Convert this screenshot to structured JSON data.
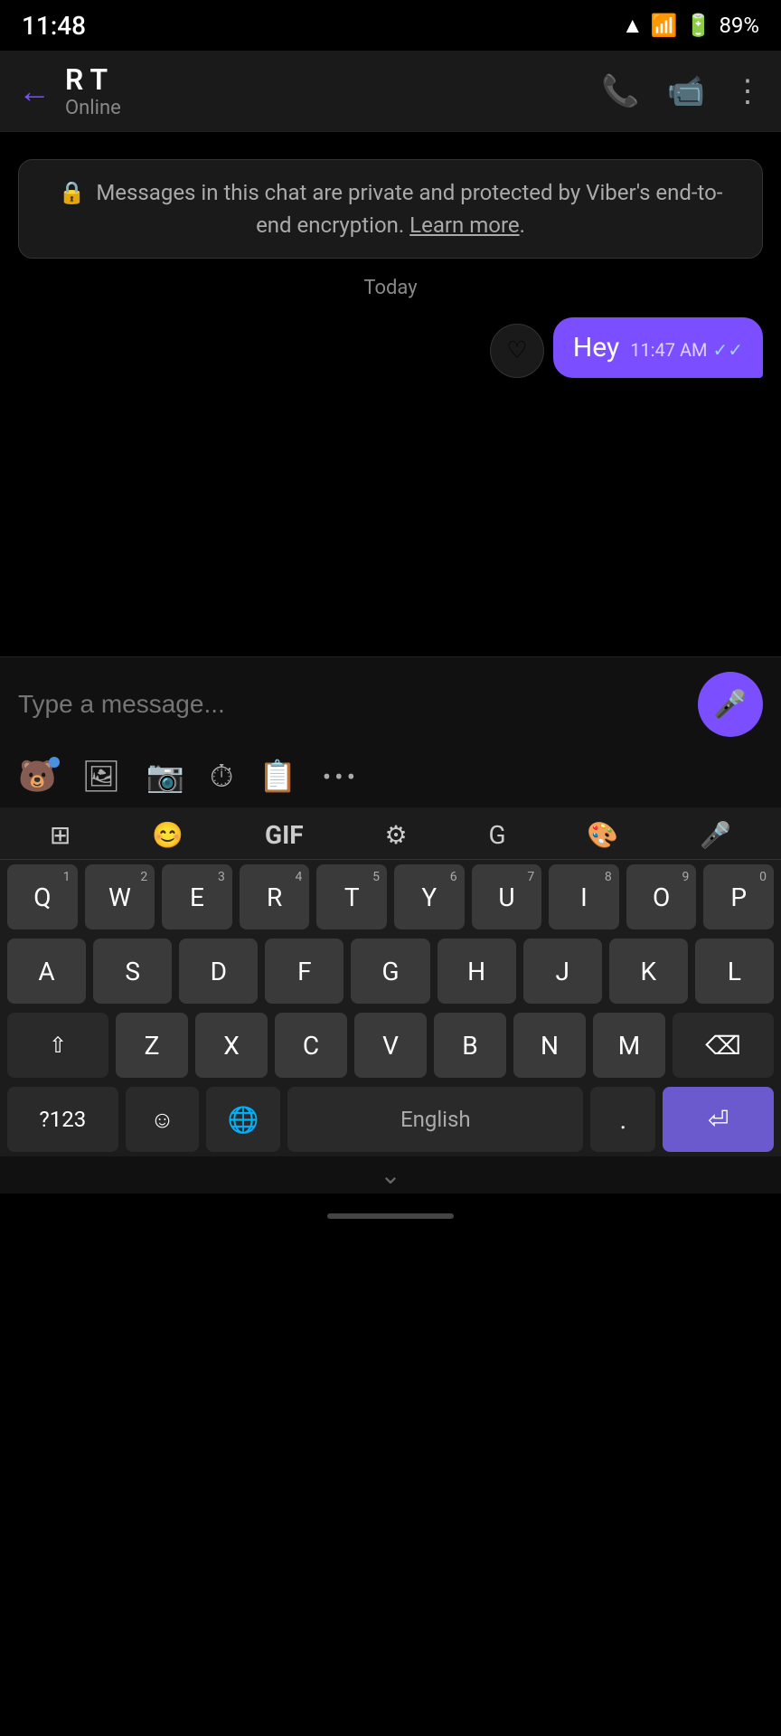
{
  "status_bar": {
    "time": "11:48",
    "battery": "89%"
  },
  "header": {
    "back_label": "←",
    "contact_name": "R T",
    "contact_status": "Online",
    "call_icon": "📞",
    "video_icon": "📹",
    "more_icon": "⋮"
  },
  "chat": {
    "encryption_notice": "Messages in this chat are private and protected by Viber's end-to-end encryption.",
    "learn_more": "Learn more",
    "date_label": "Today",
    "messages": [
      {
        "text": "Hey",
        "time": "11:47 AM",
        "ticks": "✓✓",
        "like_icon": "♡"
      }
    ]
  },
  "input_bar": {
    "placeholder": "Type a message...",
    "mic_icon": "🎤"
  },
  "toolbar": {
    "sticker_icon": "🐻",
    "image_icon": "🖼",
    "camera_icon": "📷",
    "timer_icon": "⏱",
    "note_icon": "📋",
    "more_icon": "•••"
  },
  "keyboard": {
    "top_icons": [
      "⊞",
      "😊",
      "GIF",
      "⚙",
      "Gᴬ",
      "🎨",
      "🎤"
    ],
    "rows": [
      [
        "Q",
        "W",
        "E",
        "R",
        "T",
        "Y",
        "U",
        "I",
        "O",
        "P"
      ],
      [
        "A",
        "S",
        "D",
        "F",
        "G",
        "H",
        "J",
        "K",
        "L"
      ],
      [
        "Z",
        "X",
        "C",
        "V",
        "B",
        "N",
        "M"
      ]
    ],
    "numbers": [
      "1",
      "2",
      "3",
      "4",
      "5",
      "6",
      "7",
      "8",
      "9",
      "0"
    ],
    "bottom": {
      "numbers_label": "?123",
      "emoji_label": "☺",
      "globe_label": "🌐",
      "space_label": "English",
      "period_label": ".",
      "enter_label": "⏎"
    }
  },
  "bottom_bar": {
    "chevron": "⌄"
  }
}
